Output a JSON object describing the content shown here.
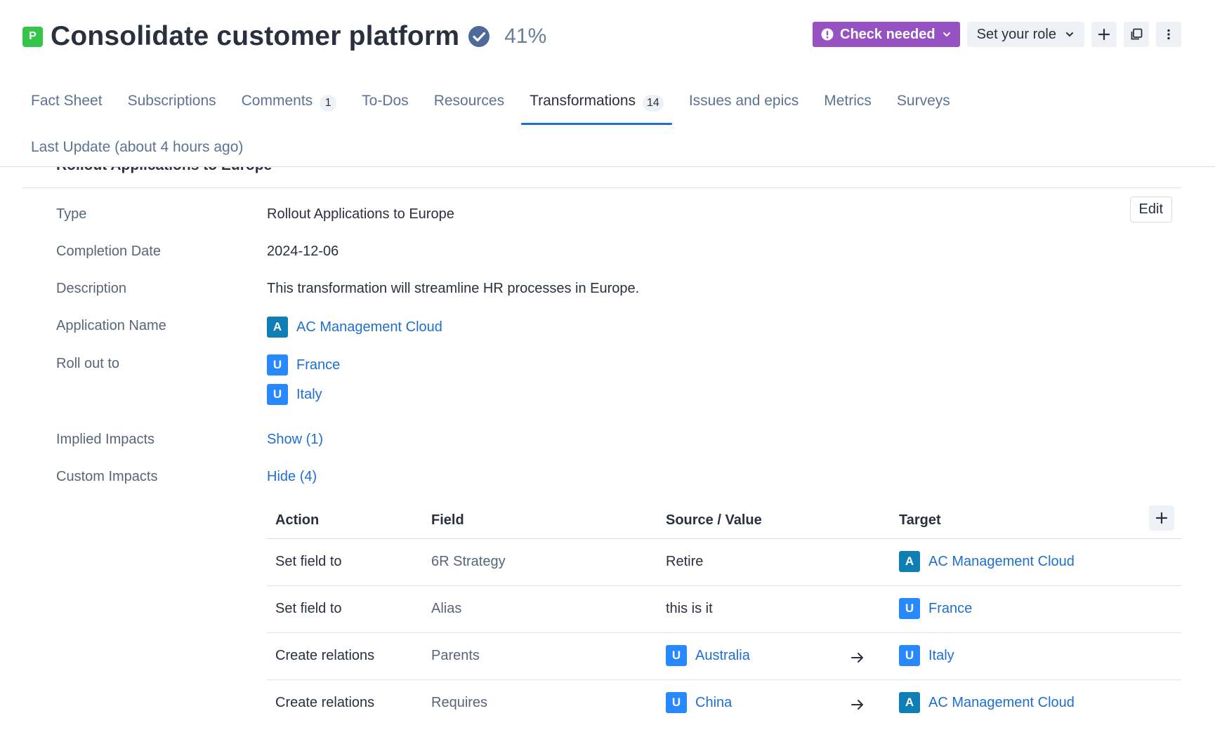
{
  "header": {
    "type_letter": "P",
    "title": "Consolidate customer platform",
    "completion": "41%",
    "check_label": "Check needed",
    "role_label": "Set your role"
  },
  "tabs": [
    {
      "label": "Fact Sheet",
      "count": ""
    },
    {
      "label": "Subscriptions",
      "count": ""
    },
    {
      "label": "Comments",
      "count": "1"
    },
    {
      "label": "To-Dos",
      "count": ""
    },
    {
      "label": "Resources",
      "count": ""
    },
    {
      "label": "Transformations",
      "count": "14"
    },
    {
      "label": "Issues and epics",
      "count": ""
    },
    {
      "label": "Metrics",
      "count": ""
    },
    {
      "label": "Surveys",
      "count": ""
    }
  ],
  "last_update": "Last Update (about 4 hours ago)",
  "section": {
    "title": "Rollout Applications to Europe",
    "edit_label": "Edit"
  },
  "details": {
    "type_label": "Type",
    "type_value": "Rollout Applications to Europe",
    "completion_label": "Completion Date",
    "completion_value": "2024-12-06",
    "description_label": "Description",
    "description_value": "This transformation will streamline HR processes in Europe.",
    "application_label": "Application Name",
    "application": {
      "letter": "A",
      "name": "AC Management Cloud"
    },
    "rollout_label": "Roll out to",
    "rollout": [
      {
        "letter": "U",
        "name": "France"
      },
      {
        "letter": "U",
        "name": "Italy"
      }
    ],
    "implied_label": "Implied Impacts",
    "implied_link": "Show (1)",
    "custom_label": "Custom Impacts",
    "custom_link": "Hide (4)"
  },
  "impacts": {
    "headers": {
      "action": "Action",
      "field": "Field",
      "source": "Source / Value",
      "target": "Target"
    },
    "rows": [
      {
        "action": "Set field to",
        "field": "6R Strategy",
        "source": "Retire",
        "source_letter": "",
        "target_letter": "A",
        "target": "AC Management Cloud"
      },
      {
        "action": "Set field to",
        "field": "Alias",
        "source": "this is it",
        "source_letter": "",
        "target_letter": "U",
        "target": "France"
      },
      {
        "action": "Create relations",
        "field": "Parents",
        "source": "Australia",
        "source_letter": "U",
        "target_letter": "U",
        "target": "Italy"
      },
      {
        "action": "Create relations",
        "field": "Requires",
        "source": "China",
        "source_letter": "U",
        "target_letter": "A",
        "target": "AC Management Cloud"
      }
    ]
  }
}
